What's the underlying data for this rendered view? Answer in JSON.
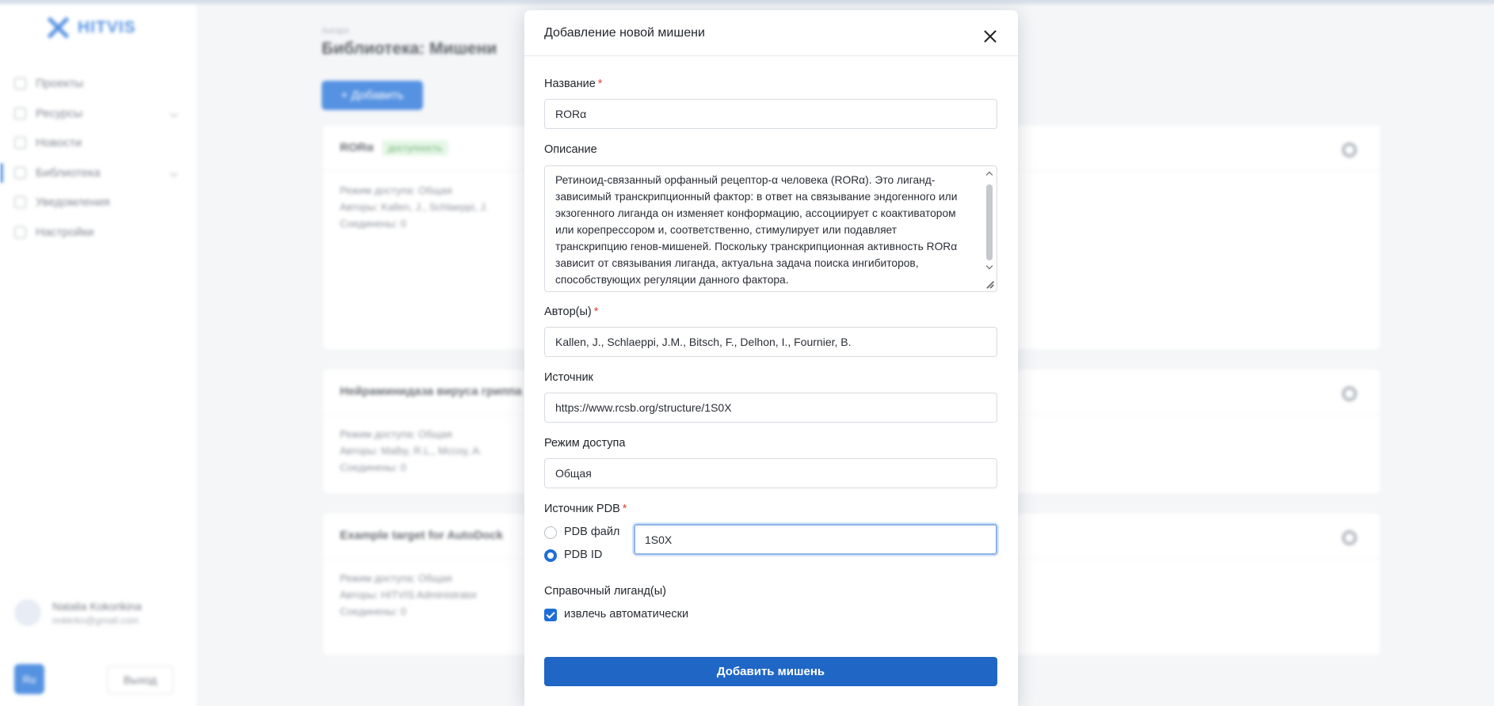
{
  "background": {
    "logo_text": "HITVIS",
    "nav": [
      {
        "label": "Проекты"
      },
      {
        "label": "Ресурсы"
      },
      {
        "label": "Новости"
      },
      {
        "label": "Библиотека"
      },
      {
        "label": "Уведомления"
      },
      {
        "label": "Настройки"
      }
    ],
    "user_name": "Natalia Kokorikina",
    "user_email": "nnkkrkn@gmail.com",
    "lang": "Ru",
    "logout": "Выход",
    "breadcrumb": "Ангарх",
    "page_title": "Библиотека: Мишени",
    "add_button": "+ Добавить",
    "badge": "доступность",
    "cards": [
      {
        "title": "RORα",
        "lines": [
          "Режим доступа: Общая",
          "Авторы: Kallen, J., Schlaeppi, J.",
          "Соединены: 0"
        ]
      },
      {
        "title": "Нейраминидаза вируса гриппа",
        "lines": [
          "Режим доступа: Общая",
          "Авторы: Malby, R.L., Mccoy, A.",
          "Соединены: 0"
        ]
      },
      {
        "title": "Example target for AutoDock",
        "lines": [
          "Режим доступа: Общая",
          "Авторы: HITVIS Administrator",
          "Соединены: 0"
        ]
      }
    ]
  },
  "modal": {
    "title": "Добавление новой мишени",
    "name_label": "Название",
    "name_value": "RORα",
    "desc_label": "Описание",
    "desc_value": "Ретиноид-связанный орфанный рецептор-α человека (RORα). Это лиганд-зависимый транскрипционный фактор: в ответ на связывание эндогенного или экзогенного лиганда он изменяет конформацию, ассоциирует с коактиватором или корепрессором и, соответственно, стимулирует или подавляет транскрипцию генов-мишеней. Поскольку транскрипционная активность RORα зависит от связывания лиганда, актуальна задача поиска ингибиторов, способствующих регуляции данного фактора.",
    "authors_label": "Автор(ы)",
    "authors_value": "Kallen, J., Schlaeppi, J.M., Bitsch, F., Delhon, I., Fournier, B.",
    "source_label": "Источник",
    "source_value": "https://www.rcsb.org/structure/1S0X",
    "access_label": "Режим доступа",
    "access_value": "Общая",
    "pdb_label": "Источник PDB",
    "pdb_options": [
      {
        "label": "PDB файл",
        "selected": false
      },
      {
        "label": "PDB ID",
        "selected": true
      }
    ],
    "pdb_id_value": "1S0X",
    "ligand_label": "Справочный лиганд(ы)",
    "auto_extract_label": "извлечь автоматически",
    "auto_extract_checked": true,
    "submit_label": "Добавить мишень",
    "required_mark": "*"
  },
  "colors": {
    "accent": "#1e6ed8",
    "submit": "#1f66c5",
    "required": "#e0453a"
  }
}
